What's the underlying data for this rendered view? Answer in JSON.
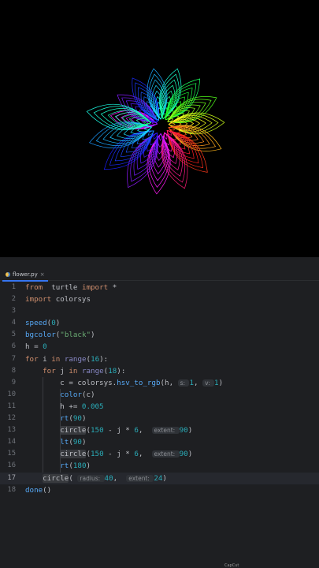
{
  "canvas": {
    "background": "#000000",
    "petals_outer": 16,
    "circles_per_petal": 18
  },
  "tab": {
    "file_name": "flower.py",
    "close_glyph": "×"
  },
  "editor": {
    "current_line": 17,
    "lines": [
      {
        "n": "1",
        "parts": [
          [
            "kw",
            "from"
          ],
          [
            "",
            "  "
          ],
          [
            "",
            "turtle "
          ],
          [
            "kw",
            "import"
          ],
          [
            "",
            " *"
          ]
        ]
      },
      {
        "n": "2",
        "parts": [
          [
            "kw",
            "import"
          ],
          [
            "",
            " colorsys"
          ]
        ]
      },
      {
        "n": "3",
        "parts": []
      },
      {
        "n": "4",
        "parts": [
          [
            "fn",
            "speed"
          ],
          [
            "",
            "("
          ],
          [
            "num",
            "0"
          ],
          [
            "",
            ")"
          ]
        ]
      },
      {
        "n": "5",
        "parts": [
          [
            "fn",
            "bgcolor"
          ],
          [
            "",
            "("
          ],
          [
            "str",
            "\"black\""
          ],
          [
            "",
            ")"
          ]
        ]
      },
      {
        "n": "6",
        "parts": [
          [
            "",
            "h = "
          ],
          [
            "num",
            "0"
          ]
        ]
      },
      {
        "n": "7",
        "parts": [
          [
            "kw",
            "for"
          ],
          [
            "",
            " i "
          ],
          [
            "kw",
            "in"
          ],
          [
            "",
            " "
          ],
          [
            "bi",
            "range"
          ],
          [
            "",
            "("
          ],
          [
            "num",
            "16"
          ],
          [
            "",
            "):"
          ]
        ]
      },
      {
        "n": "8",
        "parts": [
          [
            "",
            "    "
          ],
          [
            "kw",
            "for"
          ],
          [
            "",
            " j "
          ],
          [
            "kw",
            "in"
          ],
          [
            "",
            " "
          ],
          [
            "bi",
            "range"
          ],
          [
            "",
            "("
          ],
          [
            "num",
            "18"
          ],
          [
            "",
            "):"
          ]
        ]
      },
      {
        "n": "9",
        "parts": [
          [
            "",
            "        c = colorsys."
          ],
          [
            "fn",
            "hsv_to_rgb"
          ],
          [
            "",
            "(h, "
          ],
          [
            "hint",
            "s: "
          ],
          [
            "num",
            "1"
          ],
          [
            "",
            ", "
          ],
          [
            "hint",
            "v: "
          ],
          [
            "num",
            "1"
          ],
          [
            "",
            ")"
          ]
        ]
      },
      {
        "n": "10",
        "parts": [
          [
            "",
            "        "
          ],
          [
            "fn",
            "color"
          ],
          [
            "",
            "(c)"
          ]
        ]
      },
      {
        "n": "11",
        "parts": [
          [
            "",
            "        h += "
          ],
          [
            "num",
            "0.005"
          ]
        ]
      },
      {
        "n": "12",
        "parts": [
          [
            "",
            "        "
          ],
          [
            "fn",
            "rt"
          ],
          [
            "",
            "("
          ],
          [
            "num",
            "90"
          ],
          [
            "",
            ")"
          ]
        ]
      },
      {
        "n": "13",
        "parts": [
          [
            "",
            "        "
          ],
          [
            "hl",
            "circle"
          ],
          [
            "",
            "("
          ],
          [
            "num",
            "150"
          ],
          [
            "",
            " - j * "
          ],
          [
            "num",
            "6"
          ],
          [
            "",
            ",  "
          ],
          [
            "hint",
            "extent: "
          ],
          [
            "num",
            "90"
          ],
          [
            "",
            ")"
          ]
        ]
      },
      {
        "n": "14",
        "parts": [
          [
            "",
            "        "
          ],
          [
            "fn",
            "lt"
          ],
          [
            "",
            "("
          ],
          [
            "num",
            "90"
          ],
          [
            "",
            ")"
          ]
        ]
      },
      {
        "n": "15",
        "parts": [
          [
            "",
            "        "
          ],
          [
            "hl",
            "circle"
          ],
          [
            "",
            "("
          ],
          [
            "num",
            "150"
          ],
          [
            "",
            " - j * "
          ],
          [
            "num",
            "6"
          ],
          [
            "",
            ",  "
          ],
          [
            "hint",
            "extent: "
          ],
          [
            "num",
            "90"
          ],
          [
            "",
            ")"
          ]
        ]
      },
      {
        "n": "16",
        "parts": [
          [
            "",
            "        "
          ],
          [
            "fn",
            "rt"
          ],
          [
            "",
            "("
          ],
          [
            "num",
            "180"
          ],
          [
            "",
            ")"
          ]
        ]
      },
      {
        "n": "17",
        "parts": [
          [
            "",
            "    "
          ],
          [
            "hl",
            "circle"
          ],
          [
            "",
            "( "
          ],
          [
            "hint",
            "radius: "
          ],
          [
            "num",
            "40"
          ],
          [
            "",
            ",  "
          ],
          [
            "hint",
            "extent: "
          ],
          [
            "num",
            "24"
          ],
          [
            "",
            ")"
          ]
        ]
      },
      {
        "n": "18",
        "parts": [
          [
            "fn",
            "done"
          ],
          [
            "",
            "()"
          ]
        ]
      }
    ]
  },
  "bottom_tip": "CapCut"
}
